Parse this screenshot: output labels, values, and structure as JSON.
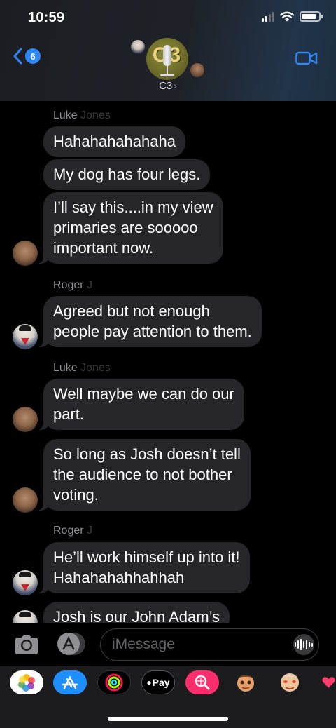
{
  "status_bar": {
    "time": "10:59",
    "signal_bars": 2,
    "battery_level": 0.85
  },
  "header": {
    "back_badge": "6",
    "group_avatar_text": "C3",
    "group_name": "C3",
    "chevron": "›",
    "icons": {
      "back": "chevron-left-icon",
      "video": "video-camera-icon"
    }
  },
  "thread": {
    "messages": [
      {
        "sender": "Luke",
        "sender_faded": "Jones",
        "text": "Hahahahahahaha"
      },
      {
        "text": "My dog has four legs."
      },
      {
        "lines": [
          "I’ll say this....in my view",
          "primaries are sooooo",
          "important now."
        ]
      },
      {
        "sender": "Roger",
        "sender_faded": "J",
        "lines": [
          "Agreed but not enough",
          "people pay attention to them."
        ]
      },
      {
        "sender": "Luke",
        "sender_faded": "Jones",
        "lines": [
          "Well maybe we can do our",
          "part."
        ]
      },
      {
        "lines": [
          "So long as Josh doesn’t tell",
          "the audience to not bother",
          "voting."
        ]
      },
      {
        "sender": "Roger",
        "sender_faded": "J",
        "lines": [
          "He’ll work himself up into it!",
          "Hahahahahhahhah"
        ]
      },
      {
        "text": "Josh is our John Adam’s"
      }
    ]
  },
  "input_bar": {
    "placeholder": "iMessage",
    "icons": {
      "camera": "camera-icon",
      "apps": "app-store-icon",
      "audio": "audio-waveform-icon"
    }
  },
  "app_strip": {
    "apple_pay_label": "Pay",
    "apps": [
      "photos-icon",
      "app-store-icon",
      "activity-icon",
      "apple-pay-icon",
      "search-images-icon",
      "memoji-icon",
      "memoji-stickers-icon",
      "heart-stickers-icon"
    ]
  },
  "colors": {
    "accent_blue": "#2e87f5",
    "bubble_gray": "#26262a",
    "sender_gray": "#8e8e93"
  }
}
